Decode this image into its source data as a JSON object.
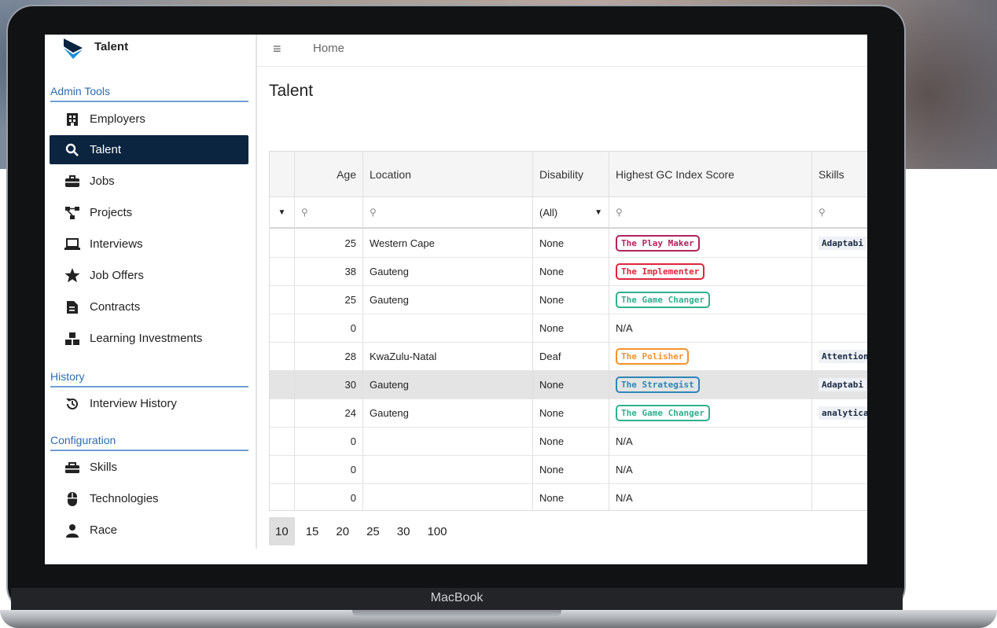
{
  "device_label": "MacBook",
  "app": {
    "title": "Talent"
  },
  "topbar": {
    "breadcrumb": "Home"
  },
  "sidebar": {
    "sections": [
      {
        "title": "Admin Tools",
        "items": [
          "Employers",
          "Talent",
          "Jobs",
          "Projects",
          "Interviews",
          "Job Offers",
          "Contracts",
          "Learning Investments"
        ]
      },
      {
        "title": "History",
        "items": [
          "Interview History"
        ]
      },
      {
        "title": "Configuration",
        "items": [
          "Skills",
          "Technologies",
          "Race"
        ]
      }
    ],
    "active_item": "Talent"
  },
  "page": {
    "title": "Talent"
  },
  "table": {
    "columns": [
      "Age",
      "Location",
      "Disability",
      "Highest GC Index Score",
      "Skills"
    ],
    "filter": {
      "disability_value": "(All)"
    },
    "rows": [
      {
        "age": "25",
        "location": "Western Cape",
        "disability": "None",
        "score": "The Play Maker",
        "skills": "Adaptabi"
      },
      {
        "age": "38",
        "location": "Gauteng",
        "disability": "None",
        "score": "The Implementer",
        "skills": ""
      },
      {
        "age": "25",
        "location": "Gauteng",
        "disability": "None",
        "score": "The Game Changer",
        "skills": ""
      },
      {
        "age": "0",
        "location": "",
        "disability": "None",
        "score": "N/A",
        "skills": ""
      },
      {
        "age": "28",
        "location": "KwaZulu-Natal",
        "disability": "Deaf",
        "score": "The Polisher",
        "skills": "Attention"
      },
      {
        "age": "30",
        "location": "Gauteng",
        "disability": "None",
        "score": "The Strategist",
        "skills": "Adaptabi"
      },
      {
        "age": "24",
        "location": "Gauteng",
        "disability": "None",
        "score": "The Game Changer",
        "skills": "analytica"
      },
      {
        "age": "0",
        "location": "",
        "disability": "None",
        "score": "N/A",
        "skills": ""
      },
      {
        "age": "0",
        "location": "",
        "disability": "None",
        "score": "N/A",
        "skills": ""
      },
      {
        "age": "0",
        "location": "",
        "disability": "None",
        "score": "N/A",
        "skills": ""
      }
    ],
    "selected_row": 5
  },
  "tag_colors": {
    "The Play Maker": "#b0245f",
    "The Implementer": "#e0243a",
    "The Game Changer": "#2fb08e",
    "The Polisher": "#f5922b",
    "The Strategist": "#2f86b6"
  },
  "pager": {
    "sizes": [
      "10",
      "15",
      "20",
      "25",
      "30",
      "100"
    ],
    "current": "10"
  }
}
